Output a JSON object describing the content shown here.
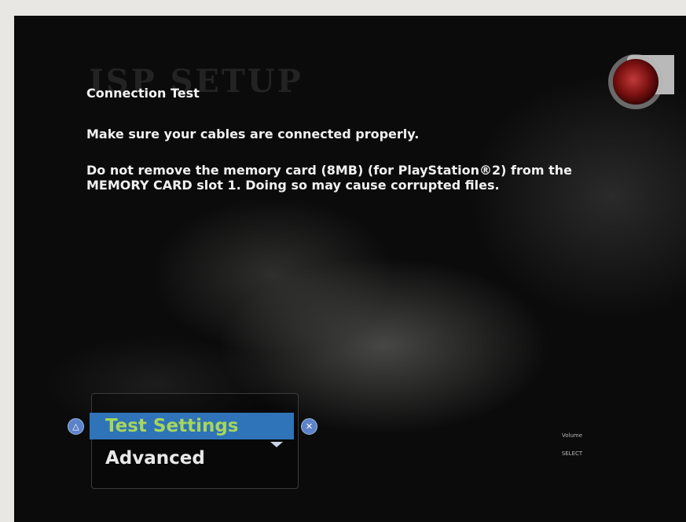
{
  "screen": {
    "ghost_title": "ISP SETUP",
    "heading": "Connection Test",
    "paragraphs": [
      "Make sure your cables are connected properly.",
      "Do not remove the memory card (8MB) (for PlayStation®2) from the MEMORY CARD slot 1. Doing so may cause corrupted files."
    ]
  },
  "menu": {
    "items": [
      {
        "label": "Test Settings",
        "selected": true
      },
      {
        "label": "Advanced",
        "selected": false
      }
    ],
    "left_button_icon": "triangle-icon",
    "right_button_icon": "cross-icon",
    "left_button_glyph": "△",
    "right_button_glyph": "✕",
    "selection_color": "#2f73b8",
    "selected_text_color": "#a6d65c"
  },
  "legend": {
    "top": "Volume",
    "mid": "SELECT"
  }
}
